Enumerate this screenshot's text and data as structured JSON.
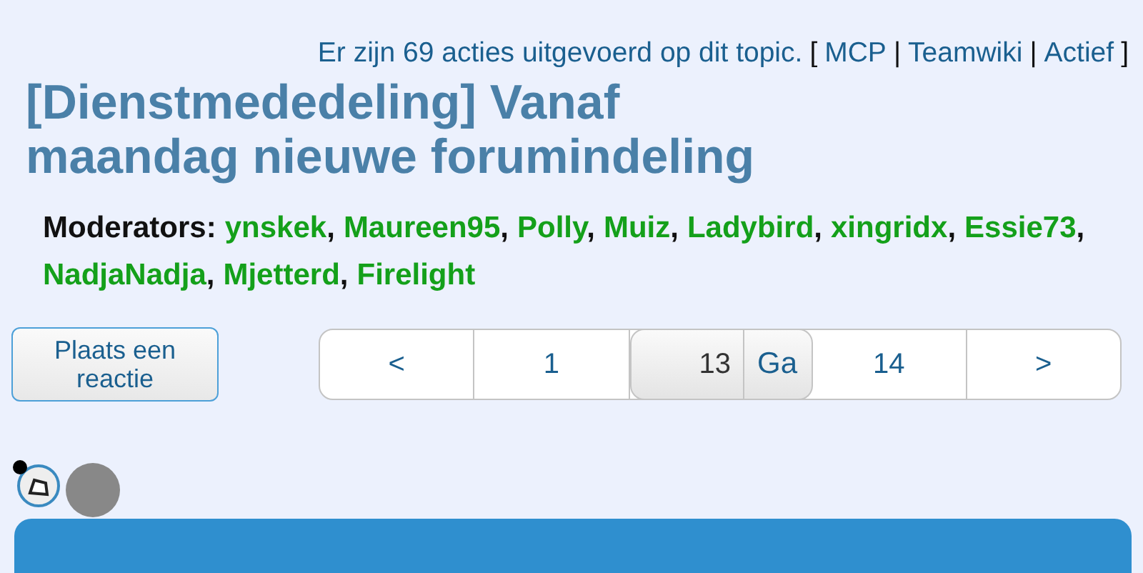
{
  "topic_info": {
    "text": "Er zijn 69 acties uitgevoerd op dit topic.",
    "open_bracket": "[",
    "links": [
      "MCP",
      "Teamwiki",
      "Actief"
    ],
    "separator": "|",
    "close_bracket": "]"
  },
  "title": "[Dienstmededeling] Vanaf maandag nieuwe forumindeling",
  "moderators": {
    "label": "Moderators:",
    "names": [
      "ynskek",
      "Maureen95",
      "Polly",
      "Muiz",
      "Ladybird",
      "xingridx",
      "Essie73",
      "NadjaNadja",
      "Mjetterd",
      "Firelight"
    ],
    "separator": ","
  },
  "reply_button": "Plaats een reactie",
  "pagination": {
    "prev": "<",
    "pages": [
      "1"
    ],
    "page_input": "13",
    "go": "Ga",
    "next_pages": [
      "14"
    ],
    "next": ">"
  }
}
